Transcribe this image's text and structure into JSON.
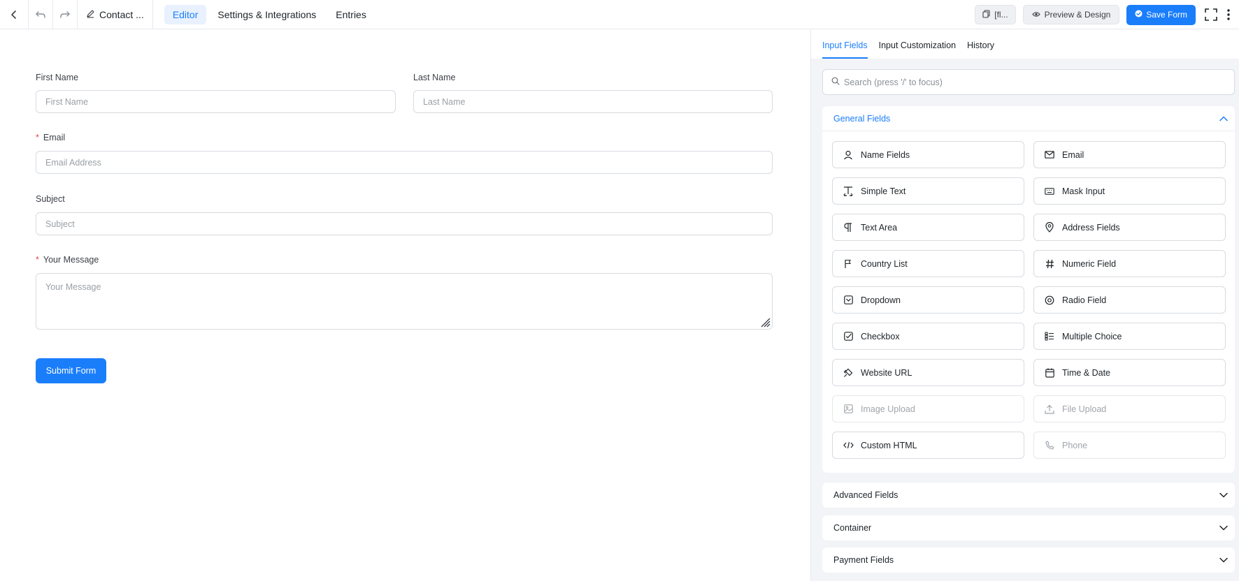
{
  "topbar": {
    "form_title": "Contact ...",
    "tabs": [
      {
        "label": "Editor",
        "active": true
      },
      {
        "label": "Settings & Integrations",
        "active": false
      },
      {
        "label": "Entries",
        "active": false
      }
    ],
    "shortcode_label": "[fl...",
    "preview_label": "Preview & Design",
    "save_label": "Save Form"
  },
  "form": {
    "first_name": {
      "label": "First Name",
      "placeholder": "First Name"
    },
    "last_name": {
      "label": "Last Name",
      "placeholder": "Last Name"
    },
    "email": {
      "label": "Email",
      "placeholder": "Email Address",
      "required": true
    },
    "subject": {
      "label": "Subject",
      "placeholder": "Subject"
    },
    "message": {
      "label": "Your Message",
      "placeholder": "Your Message",
      "required": true
    },
    "required_mark": "*",
    "submit_label": "Submit Form"
  },
  "panel": {
    "tabs": [
      {
        "label": "Input Fields",
        "active": true
      },
      {
        "label": "Input Customization",
        "active": false
      },
      {
        "label": "History",
        "active": false
      }
    ],
    "search_placeholder": "Search (press '/' to focus)",
    "general": {
      "title": "General Fields",
      "fields": [
        {
          "label": "Name Fields",
          "icon": "person-icon",
          "disabled": false
        },
        {
          "label": "Email",
          "icon": "envelope-icon",
          "disabled": false
        },
        {
          "label": "Simple Text",
          "icon": "text-cursor-icon",
          "disabled": false
        },
        {
          "label": "Mask Input",
          "icon": "keyboard-icon",
          "disabled": false
        },
        {
          "label": "Text Area",
          "icon": "paragraph-icon",
          "disabled": false
        },
        {
          "label": "Address Fields",
          "icon": "map-pin-icon",
          "disabled": false
        },
        {
          "label": "Country List",
          "icon": "flag-icon",
          "disabled": false
        },
        {
          "label": "Numeric Field",
          "icon": "hash-icon",
          "disabled": false
        },
        {
          "label": "Dropdown",
          "icon": "dropdown-icon",
          "disabled": false
        },
        {
          "label": "Radio Field",
          "icon": "radio-icon",
          "disabled": false
        },
        {
          "label": "Checkbox",
          "icon": "checkbox-icon",
          "disabled": false
        },
        {
          "label": "Multiple Choice",
          "icon": "list-icon",
          "disabled": false
        },
        {
          "label": "Website URL",
          "icon": "link-icon",
          "disabled": false
        },
        {
          "label": "Time & Date",
          "icon": "calendar-icon",
          "disabled": false
        },
        {
          "label": "Image Upload",
          "icon": "image-icon",
          "disabled": true
        },
        {
          "label": "File Upload",
          "icon": "upload-icon",
          "disabled": true
        },
        {
          "label": "Custom HTML",
          "icon": "code-icon",
          "disabled": false
        },
        {
          "label": "Phone",
          "icon": "phone-icon",
          "disabled": true
        }
      ]
    },
    "collapsed_sections": [
      {
        "title": "Advanced Fields"
      },
      {
        "title": "Container"
      },
      {
        "title": "Payment Fields"
      }
    ]
  }
}
